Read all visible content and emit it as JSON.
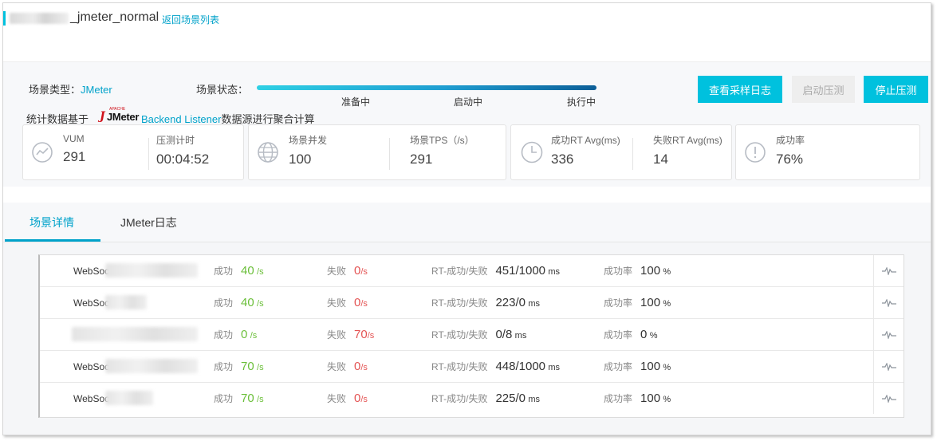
{
  "header": {
    "title": "_jmeter_normal",
    "back_link": "返回场景列表"
  },
  "scene": {
    "type_label": "场景类型：",
    "type_value": "JMeter",
    "status_label": "场景状态：",
    "stages": [
      "准备中",
      "启动中",
      "执行中"
    ]
  },
  "stats_note": {
    "prefix": "统计数据基于",
    "logo_text": "JMeter",
    "logo_small": "APACHE",
    "link": "Backend Listener",
    "suffix": "数据源进行聚合计算"
  },
  "buttons": {
    "view_log": "查看采样日志",
    "start": "启动压测",
    "stop": "停止压测"
  },
  "metrics": {
    "vum": {
      "label": "VUM",
      "value": "291"
    },
    "timer": {
      "label": "压测计时",
      "value": "00:04:52"
    },
    "concurrency": {
      "label": "场景并发",
      "value": "100"
    },
    "tps": {
      "label": "场景TPS（/s）",
      "value": "291"
    },
    "rt_success": {
      "label": "成功RT Avg(ms)",
      "value": "336"
    },
    "rt_fail": {
      "label": "失败RT Avg(ms)",
      "value": "14"
    },
    "success_rate": {
      "label": "成功率",
      "value": "76%"
    }
  },
  "tabs": [
    {
      "label": "场景详情",
      "active": true
    },
    {
      "label": "JMeter日志",
      "active": false
    }
  ],
  "table": {
    "labels": {
      "success": "成功",
      "fail": "失败",
      "rt": "RT-成功/失败",
      "rate": "成功率",
      "per_sec": "/s",
      "ms": "ms",
      "pct": "%"
    },
    "rows": [
      {
        "name": "WebSoc",
        "success": "40",
        "fail": "0",
        "rt": "451/1000",
        "rate": "100"
      },
      {
        "name": "WebSoc",
        "success": "40",
        "fail": "0",
        "rt": "223/0",
        "rate": "100"
      },
      {
        "name": "",
        "success": "0",
        "fail": "70",
        "rt": "0/8",
        "rate": "0"
      },
      {
        "name": "WebSoc",
        "success": "70",
        "fail": "0",
        "rt": "448/1000",
        "rate": "100"
      },
      {
        "name": "WebSoc",
        "success": "70",
        "fail": "0",
        "rt": "225/0",
        "rate": "100"
      }
    ]
  },
  "colors": {
    "accent": "#00c1de",
    "link": "#00a2ca",
    "success": "#6bbf3a",
    "fail": "#e45454"
  }
}
